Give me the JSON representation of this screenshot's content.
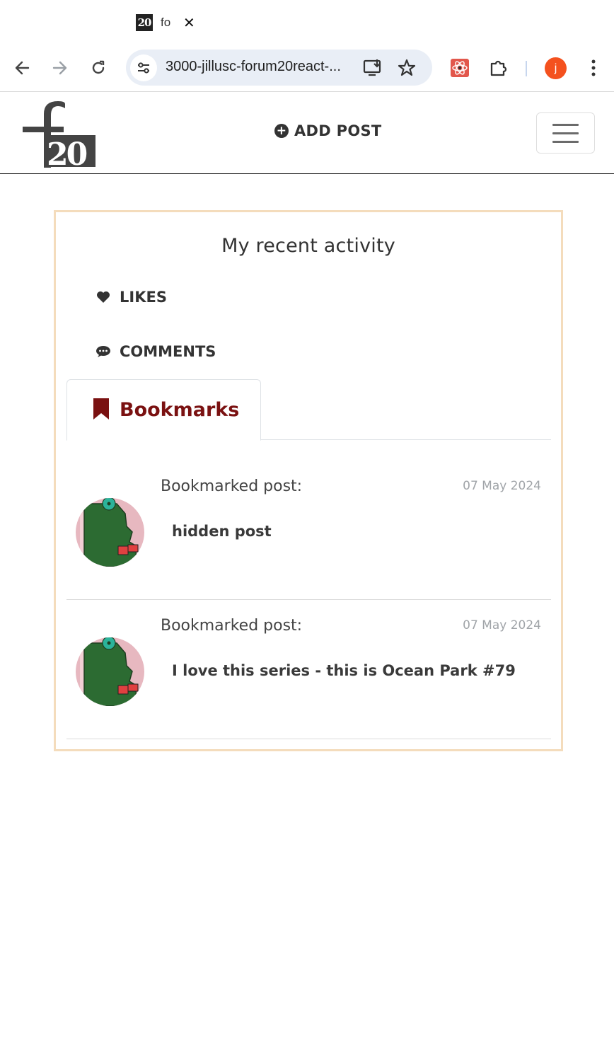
{
  "browser": {
    "tab": {
      "favicon_text": "20",
      "title": "fo"
    },
    "url": "3000-jillusc-forum20react-...",
    "profile_initial": "j"
  },
  "navbar": {
    "add_post_label": "ADD POST"
  },
  "activity": {
    "title": "My recent activity",
    "menu": [
      {
        "label": "LIKES",
        "icon": "heart-icon"
      },
      {
        "label": "COMMENTS",
        "icon": "comment-icon"
      }
    ],
    "active_tab": {
      "label": "Bookmarks",
      "icon": "bookmark-icon",
      "color": "#7a1111"
    },
    "posts": [
      {
        "kind": "Bookmarked post:",
        "date": "07 May 2024",
        "title": "hidden post"
      },
      {
        "kind": "Bookmarked post:",
        "date": "07 May 2024",
        "title": "I love this series - this is Ocean Park #79"
      }
    ]
  },
  "colors": {
    "card_border": "#f4dcbc",
    "profile": "#f4511e",
    "omnibox": "#e9eef6"
  }
}
